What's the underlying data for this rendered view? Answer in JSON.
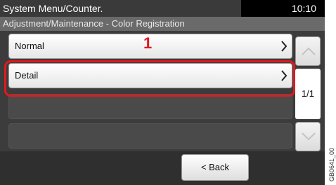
{
  "header": {
    "title": "System Menu/Counter.",
    "time": "10:10",
    "subtitle": "Adjustment/Maintenance - Color Registration"
  },
  "list": {
    "items": [
      {
        "label": "Normal"
      },
      {
        "label": "Detail"
      }
    ]
  },
  "pagination": {
    "indicator": "1/1"
  },
  "footer": {
    "back_label": "< Back"
  },
  "annotation": {
    "step_number": "1"
  },
  "figure_code": "GB0641_00",
  "colors": {
    "highlight": "#e0191f"
  }
}
